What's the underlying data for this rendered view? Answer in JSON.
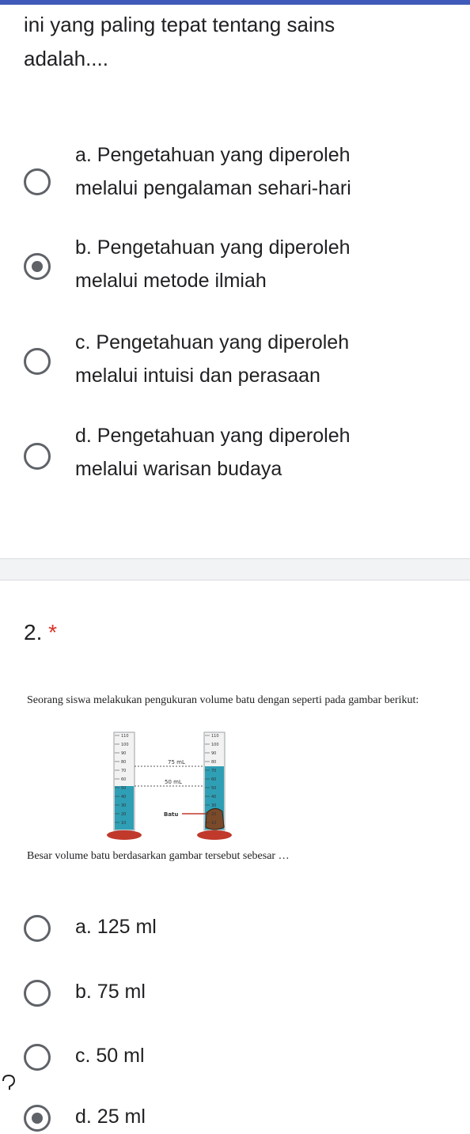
{
  "question1": {
    "text_line1": "ini yang paling tepat tentang sains",
    "text_line2": "adalah....",
    "options": [
      {
        "line1": "a. Pengetahuan yang diperoleh",
        "line2": "melalui pengalaman sehari-hari",
        "selected": false
      },
      {
        "line1": "b. Pengetahuan yang diperoleh",
        "line2": "melalui metode ilmiah",
        "selected": true
      },
      {
        "line1": "c. Pengetahuan yang diperoleh",
        "line2": "melalui intuisi dan perasaan",
        "selected": false
      },
      {
        "line1": "d. Pengetahuan yang diperoleh",
        "line2": "melalui warisan budaya",
        "selected": false
      }
    ]
  },
  "question2": {
    "number": "2.",
    "required_mark": "*",
    "statement": "Seorang siswa melakukan pengukuran volume batu dengan seperti pada gambar berikut:",
    "ask": "Besar  volume batu berdasarkan gambar tersebut sebesar …",
    "figure": {
      "label_75": "75 mL",
      "label_50": "50 mL",
      "label_batu": "Batu",
      "ticks_left": [
        "110",
        "100",
        "90",
        "80",
        "70",
        "60",
        "50",
        "40",
        "30",
        "20",
        "10"
      ],
      "ticks_right": [
        "110",
        "100",
        "90",
        "80",
        "70",
        "60",
        "50",
        "40",
        "30",
        "20",
        "10"
      ]
    },
    "options": [
      {
        "label": "a. 125 ml",
        "selected": false
      },
      {
        "label": "b. 75 ml",
        "selected": false
      },
      {
        "label": "c. 50 ml",
        "selected": false
      },
      {
        "label": "d. 25 ml",
        "selected": true
      }
    ]
  },
  "colors": {
    "accent": "#3f5ab8",
    "required": "#d93025",
    "radio": "#5f6368",
    "water": "#2e9fb5",
    "base": "#c0392b"
  },
  "icons": {
    "help": "question-mark-icon"
  }
}
